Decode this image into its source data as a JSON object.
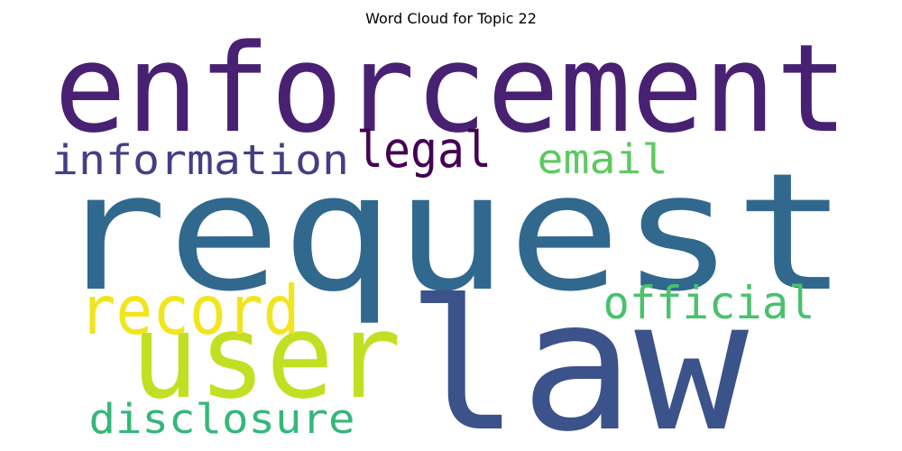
{
  "chart_data": {
    "type": "wordcloud",
    "title": "Word Cloud for Topic 22",
    "words": [
      {
        "text": "request",
        "color": "#31688e"
      },
      {
        "text": "law",
        "color": "#3b528b"
      },
      {
        "text": "enforcement",
        "color": "#482173"
      },
      {
        "text": "user",
        "color": "#c2df23"
      },
      {
        "text": "information",
        "color": "#433e85"
      },
      {
        "text": "legal",
        "color": "#440154"
      },
      {
        "text": "email",
        "color": "#5ec962"
      },
      {
        "text": "record",
        "color": "#f1e51d"
      },
      {
        "text": "official",
        "color": "#4ac16d"
      },
      {
        "text": "disclosure",
        "color": "#35b779"
      }
    ]
  }
}
